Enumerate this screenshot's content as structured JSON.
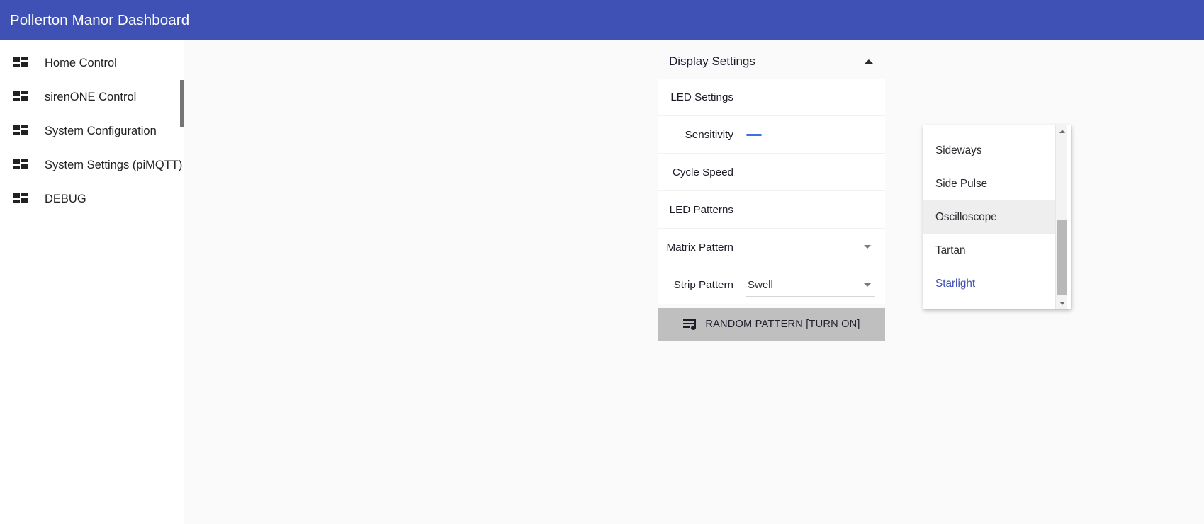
{
  "header": {
    "title": "Pollerton Manor Dashboard",
    "background_color": "#3f51b5"
  },
  "sidebar": {
    "items": [
      {
        "label": "Home Control",
        "icon": "dashboard-grid-icon"
      },
      {
        "label": "sirenONE Control",
        "icon": "dashboard-grid-icon"
      },
      {
        "label": "System Configuration",
        "icon": "dashboard-grid-icon"
      },
      {
        "label": "System Settings (piMQTT)",
        "icon": "dashboard-grid-icon"
      },
      {
        "label": "DEBUG",
        "icon": "dashboard-grid-icon"
      }
    ],
    "scrollbar": {
      "visible": true,
      "thumb_color": "#757575"
    }
  },
  "panel": {
    "title": "Display Settings",
    "collapse_icon": "chevron-up-icon",
    "rows": [
      {
        "label": "LED Settings",
        "control": "none",
        "value": ""
      },
      {
        "label": "Sensitivity",
        "control": "slider",
        "value": ""
      },
      {
        "label": "Cycle Speed",
        "control": "none",
        "value": ""
      },
      {
        "label": "LED Patterns",
        "control": "none",
        "value": ""
      },
      {
        "label": "Matrix Pattern",
        "control": "select",
        "value": ""
      },
      {
        "label": "Strip Pattern",
        "control": "select",
        "value": "Swell"
      }
    ],
    "random_button": {
      "label": "RANDOM PATTERN [TURN ON]",
      "icon": "queue-music-icon",
      "background_color": "#bfbfbf"
    }
  },
  "dropdown": {
    "open": true,
    "options": [
      {
        "label": "Sideways",
        "state": "normal"
      },
      {
        "label": "Side Pulse",
        "state": "normal"
      },
      {
        "label": "Oscilloscope",
        "state": "hovered"
      },
      {
        "label": "Tartan",
        "state": "normal"
      },
      {
        "label": "Starlight",
        "state": "selected"
      }
    ],
    "selected_color": "#3f51b5",
    "hover_color": "#eeeeee",
    "scrollbar": {
      "up_icon": "scroll-up-arrow-icon",
      "down_icon": "scroll-down-arrow-icon",
      "thumb_color": "#b8b8b8"
    }
  }
}
